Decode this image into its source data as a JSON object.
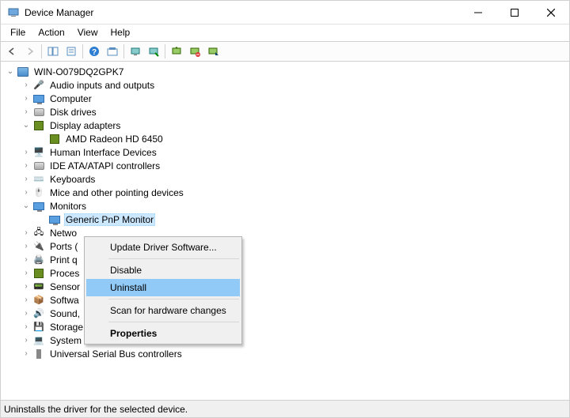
{
  "window": {
    "title": "Device Manager"
  },
  "menu": {
    "file": "File",
    "action": "Action",
    "view": "View",
    "help": "Help"
  },
  "tree": {
    "root": "WIN-O079DQ2GPK7",
    "audio": "Audio inputs and outputs",
    "computer": "Computer",
    "diskdrives": "Disk drives",
    "displayadapters": "Display adapters",
    "amd": "AMD Radeon HD 6450",
    "hid": "Human Interface Devices",
    "ide": "IDE ATA/ATAPI controllers",
    "keyboards": "Keyboards",
    "mice": "Mice and other pointing devices",
    "monitors": "Monitors",
    "pnpmonitor": "Generic PnP Monitor",
    "network": "Netwo",
    "ports": "Ports (",
    "printq": "Print q",
    "processors": "Proces",
    "sensors": "Sensor",
    "software": "Softwa",
    "sound": "Sound,",
    "storage": "Storage controllers",
    "system": "System devices",
    "usb": "Universal Serial Bus controllers"
  },
  "context": {
    "update": "Update Driver Software...",
    "disable": "Disable",
    "uninstall": "Uninstall",
    "scan": "Scan for hardware changes",
    "properties": "Properties"
  },
  "status": {
    "text": "Uninstalls the driver for the selected device."
  }
}
